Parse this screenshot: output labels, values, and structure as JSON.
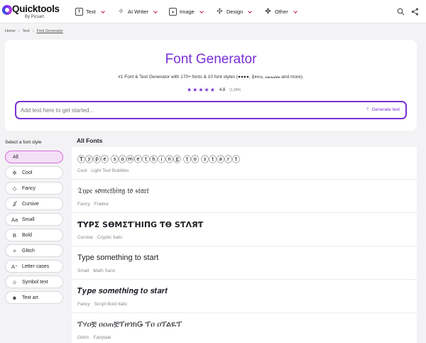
{
  "header": {
    "logo_text": "Quicktools",
    "logo_sub": "By Picsart",
    "nav": [
      {
        "label": "Text",
        "icon": "text-icon"
      },
      {
        "label": "AI Writer",
        "icon": "sparkle-icon"
      },
      {
        "label": "Image",
        "icon": "image-icon"
      },
      {
        "label": "Design",
        "icon": "design-icon"
      },
      {
        "label": "Other",
        "icon": "grid-icon"
      }
    ],
    "right_icons": [
      "search-icon",
      "share-icon"
    ]
  },
  "breadcrumb": [
    "Home",
    "Text",
    "Font Generator"
  ],
  "hero": {
    "title": "Font Generator",
    "subtitle_prefix": "#1 Font & Text Generator with 170+ fonts & 10 font styles (",
    "subtitle_bubbles": "●●●●",
    "subtitle_sep1": ", ",
    "subtitle_fancy": "𝔉𝔞𝔫𝔠𝔶",
    "subtitle_sep2": ", ",
    "subtitle_cursive": "𝓬𝓾𝓻𝓼𝓲𝓿𝓮",
    "subtitle_suffix": " and more).",
    "rating_value": "4.8",
    "rating_count": "(1,284)",
    "stars": 5,
    "input_placeholder": "Add text here to get started...",
    "generate_label": "Generate text"
  },
  "sidebar": {
    "title": "Select a font style",
    "items": [
      {
        "label": "All",
        "icon": ""
      },
      {
        "label": "Cool",
        "icon": "✲"
      },
      {
        "label": "Fancy",
        "icon": "◇"
      },
      {
        "label": "Cursive",
        "icon": "𝒥"
      },
      {
        "label": "Small",
        "icon": "Aa"
      },
      {
        "label": "Bold",
        "icon": "B"
      },
      {
        "label": "Glitch",
        "icon": "✧"
      },
      {
        "label": "Letter cases",
        "icon": "A⁺"
      },
      {
        "label": "Symbol text",
        "icon": "☺"
      },
      {
        "label": "Text art",
        "icon": "☻"
      }
    ]
  },
  "main": {
    "title": "All Fonts",
    "fonts": [
      {
        "sample": "Ⓣⓨⓟⓔ ⓢⓞⓜⓔⓣⓗⓘⓝⓖ ⓣⓞ ⓢⓣⓐⓡⓣ",
        "category": "Cool",
        "name": "Light Text Bubbles"
      },
      {
        "sample": "𝔗𝔶𝔭𝔢 𝔰𝔬𝔪𝔢𝔱𝔥𝔦𝔫𝔤 𝔱𝔬 𝔰𝔱𝔞𝔯𝔱",
        "category": "Fancy",
        "name": "Fraktur"
      },
      {
        "sample": "ƬYPΣ SӨMΣƬΉIПG ƬӨ SƬΛЯƬ",
        "category": "Cursive",
        "name": "Cryptic Italic"
      },
      {
        "sample": "Type something to start",
        "category": "Small",
        "name": "Math Sans"
      },
      {
        "sample": "𝑻𝒚𝒑𝒆 𝒔𝒐𝒎𝒆𝒕𝒉𝒊𝒏𝒈 𝒕𝒐 𝒔𝒕𝒂𝒓𝒕",
        "category": "Fancy",
        "name": "Script Bold Italic"
      },
      {
        "sample": "ፕሃዐቿ ዐዐጠቿፕዘጎክǤ ፕዐ ዐፕልዪፕ",
        "category": "Glitch",
        "name": "Fairytale"
      }
    ]
  },
  "colors": {
    "accent": "#7a2fd6",
    "active_bg": "#f5dff7"
  }
}
